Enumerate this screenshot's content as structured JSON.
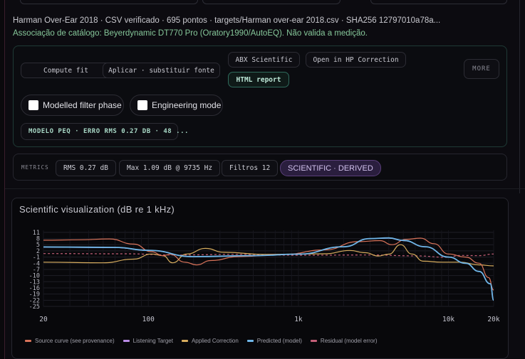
{
  "header": {
    "file_line": "Harman Over-Ear 2018 · CSV verificado · 695 pontos · targets/Harman over-ear 2018.csv · SHA256 12797010a78a...",
    "catalog_line": "Associação de catálogo: Beyerdynamic DT770 Pro (Oratory1990/AutoEQ). Não valida a medição."
  },
  "actions": {
    "compute_fit": "Compute fit",
    "apply_replace_source": "Aplicar · substituir fonte",
    "abx_scientific": "ABX Scientific",
    "open_hp_correction": "Open in HP Correction",
    "html_report": "HTML report",
    "more": "MORE"
  },
  "toggles": {
    "modelled_filter_phase": "Modelled filter phase",
    "engineering_mode": "Engineering mode"
  },
  "model_status": "MODELO PEQ · ERRO RMS 0.27 DB · 48 ...",
  "metrics": {
    "label": "METRICS",
    "rms": "RMS 0.27 dB",
    "max": "Max 1.09 dB @ 9735 Hz",
    "filters": "Filtros 12",
    "scientific_badge": "SCIENTIFIC · DERIVED"
  },
  "colors": {
    "source_curve": "#d9735a",
    "listening_target": "#b98be6",
    "applied_correction": "#d8ad5e",
    "predicted": "#6fb6e8",
    "residual": "#c45f78"
  },
  "chart_data": {
    "type": "line",
    "title": "Scientific visualization (dB re 1 kHz)",
    "xlabel": "",
    "ylabel": "",
    "x_scale": "log",
    "xlim": [
      20,
      20000
    ],
    "ylim": [
      -25,
      12
    ],
    "x_ticks": [
      {
        "value": 20,
        "label": "20"
      },
      {
        "value": 100,
        "label": "100"
      },
      {
        "value": 1000,
        "label": "1k"
      },
      {
        "value": 10000,
        "label": "10k"
      },
      {
        "value": 20000,
        "label": "20k"
      }
    ],
    "y_ticks": [
      11,
      8,
      5,
      2,
      -1,
      -4,
      -7,
      -10,
      -13,
      -16,
      -19,
      -22,
      -25
    ],
    "grid": true,
    "legend_placement": "bottom",
    "series": [
      {
        "name": "Source curve (see provenance)",
        "color_key": "source_curve",
        "style": "solid",
        "points": [
          [
            20,
            7.2
          ],
          [
            35,
            7.4
          ],
          [
            55,
            7.8
          ],
          [
            80,
            5.3
          ],
          [
            105,
            1.6
          ],
          [
            125,
            -0.3
          ],
          [
            140,
            0.3
          ],
          [
            175,
            -3.5
          ],
          [
            210,
            -4.8
          ],
          [
            260,
            -2.7
          ],
          [
            400,
            -0.8
          ],
          [
            800,
            0.3
          ],
          [
            1500,
            2.5
          ],
          [
            2500,
            6.5
          ],
          [
            3500,
            7.0
          ],
          [
            4200,
            5.0
          ],
          [
            5200,
            7.6
          ],
          [
            6500,
            8.2
          ],
          [
            8000,
            5.5
          ],
          [
            10000,
            0.5
          ],
          [
            13000,
            -1.0
          ],
          [
            16000,
            -4.0
          ],
          [
            18500,
            -11.0
          ],
          [
            20000,
            -17.0
          ]
        ]
      },
      {
        "name": "Listening Target",
        "color_key": "listening_target",
        "style": "solid",
        "points": [
          [
            20,
            3.8
          ],
          [
            60,
            3.6
          ],
          [
            100,
            2.2
          ],
          [
            200,
            -0.8
          ],
          [
            500,
            -0.3
          ],
          [
            1000,
            0.4
          ],
          [
            2000,
            4.0
          ],
          [
            3000,
            8.0
          ],
          [
            4000,
            8.2
          ],
          [
            5000,
            7.0
          ],
          [
            7000,
            4.0
          ],
          [
            10000,
            -1.0
          ],
          [
            13000,
            -4.0
          ],
          [
            16000,
            -8.0
          ],
          [
            19000,
            -14.0
          ],
          [
            20000,
            -22.0
          ]
        ]
      },
      {
        "name": "Applied Correction",
        "color_key": "applied_correction",
        "style": "solid",
        "points": [
          [
            20,
            -3.5
          ],
          [
            50,
            -3.8
          ],
          [
            80,
            -2.0
          ],
          [
            105,
            0.5
          ],
          [
            125,
            -0.3
          ],
          [
            145,
            -3.8
          ],
          [
            180,
            0.5
          ],
          [
            240,
            3.2
          ],
          [
            320,
            1.3
          ],
          [
            600,
            0.3
          ],
          [
            1500,
            0.6
          ],
          [
            2200,
            2.2
          ],
          [
            2800,
            1.1
          ],
          [
            3400,
            -0.5
          ],
          [
            4000,
            0.4
          ],
          [
            4800,
            5.0
          ],
          [
            5700,
            0.5
          ],
          [
            6800,
            -3.0
          ],
          [
            9000,
            -3.5
          ],
          [
            12000,
            -3.5
          ],
          [
            16000,
            -4.8
          ],
          [
            20000,
            -5.3
          ]
        ]
      },
      {
        "name": "Predicted (model)",
        "color_key": "predicted",
        "style": "solid",
        "points": [
          [
            20,
            3.9
          ],
          [
            60,
            3.7
          ],
          [
            100,
            2.3
          ],
          [
            200,
            -0.8
          ],
          [
            500,
            -0.3
          ],
          [
            1000,
            0.4
          ],
          [
            2000,
            4.0
          ],
          [
            3000,
            8.0
          ],
          [
            4000,
            8.3
          ],
          [
            5000,
            7.1
          ],
          [
            7000,
            4.0
          ],
          [
            10000,
            -1.0
          ],
          [
            13000,
            -4.0
          ],
          [
            16000,
            -8.0
          ],
          [
            19000,
            -14.0
          ],
          [
            20000,
            -22.0
          ]
        ]
      },
      {
        "name": "Residual (model error)",
        "color_key": "residual",
        "style": "dashed",
        "points": [
          [
            20,
            0.7
          ],
          [
            70,
            0.6
          ],
          [
            150,
            0.0
          ],
          [
            400,
            0.3
          ],
          [
            1000,
            -0.1
          ],
          [
            3000,
            0.0
          ],
          [
            6000,
            -0.4
          ],
          [
            9735,
            -1.09
          ],
          [
            12000,
            -0.2
          ],
          [
            16000,
            -0.3
          ],
          [
            20000,
            0.5
          ]
        ]
      }
    ]
  }
}
